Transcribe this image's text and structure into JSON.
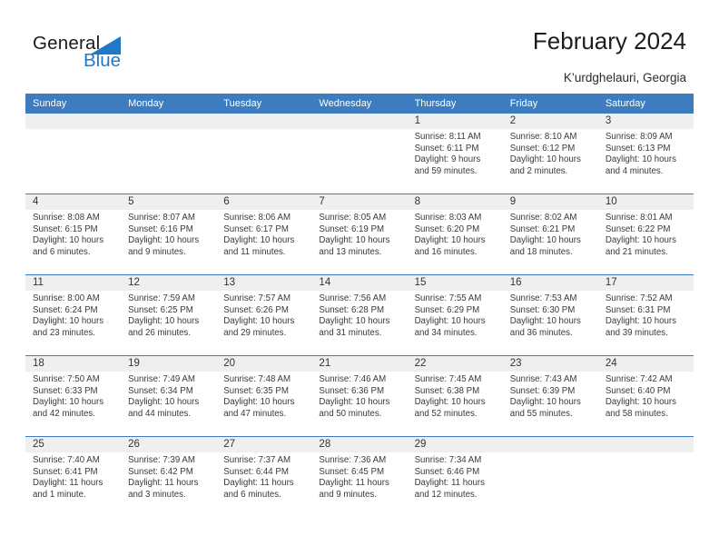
{
  "branding": {
    "name_part1": "General",
    "name_part2": "Blue",
    "triangle_color": "#2079c6",
    "text_color": "#1b1b1b"
  },
  "header": {
    "title": "February 2024",
    "location": "K’urdghelauri, Georgia",
    "header_bg": "#3c7cbf",
    "band_bg": "#efefef"
  },
  "weekdays": [
    "Sunday",
    "Monday",
    "Tuesday",
    "Wednesday",
    "Thursday",
    "Friday",
    "Saturday"
  ],
  "weeks": [
    [
      {
        "day": "",
        "sunrise": "",
        "sunset": "",
        "daylight": ""
      },
      {
        "day": "",
        "sunrise": "",
        "sunset": "",
        "daylight": ""
      },
      {
        "day": "",
        "sunrise": "",
        "sunset": "",
        "daylight": ""
      },
      {
        "day": "",
        "sunrise": "",
        "sunset": "",
        "daylight": ""
      },
      {
        "day": "1",
        "sunrise": "Sunrise: 8:11 AM",
        "sunset": "Sunset: 6:11 PM",
        "daylight": "Daylight: 9 hours and 59 minutes."
      },
      {
        "day": "2",
        "sunrise": "Sunrise: 8:10 AM",
        "sunset": "Sunset: 6:12 PM",
        "daylight": "Daylight: 10 hours and 2 minutes."
      },
      {
        "day": "3",
        "sunrise": "Sunrise: 8:09 AM",
        "sunset": "Sunset: 6:13 PM",
        "daylight": "Daylight: 10 hours and 4 minutes."
      }
    ],
    [
      {
        "day": "4",
        "sunrise": "Sunrise: 8:08 AM",
        "sunset": "Sunset: 6:15 PM",
        "daylight": "Daylight: 10 hours and 6 minutes."
      },
      {
        "day": "5",
        "sunrise": "Sunrise: 8:07 AM",
        "sunset": "Sunset: 6:16 PM",
        "daylight": "Daylight: 10 hours and 9 minutes."
      },
      {
        "day": "6",
        "sunrise": "Sunrise: 8:06 AM",
        "sunset": "Sunset: 6:17 PM",
        "daylight": "Daylight: 10 hours and 11 minutes."
      },
      {
        "day": "7",
        "sunrise": "Sunrise: 8:05 AM",
        "sunset": "Sunset: 6:19 PM",
        "daylight": "Daylight: 10 hours and 13 minutes."
      },
      {
        "day": "8",
        "sunrise": "Sunrise: 8:03 AM",
        "sunset": "Sunset: 6:20 PM",
        "daylight": "Daylight: 10 hours and 16 minutes."
      },
      {
        "day": "9",
        "sunrise": "Sunrise: 8:02 AM",
        "sunset": "Sunset: 6:21 PM",
        "daylight": "Daylight: 10 hours and 18 minutes."
      },
      {
        "day": "10",
        "sunrise": "Sunrise: 8:01 AM",
        "sunset": "Sunset: 6:22 PM",
        "daylight": "Daylight: 10 hours and 21 minutes."
      }
    ],
    [
      {
        "day": "11",
        "sunrise": "Sunrise: 8:00 AM",
        "sunset": "Sunset: 6:24 PM",
        "daylight": "Daylight: 10 hours and 23 minutes."
      },
      {
        "day": "12",
        "sunrise": "Sunrise: 7:59 AM",
        "sunset": "Sunset: 6:25 PM",
        "daylight": "Daylight: 10 hours and 26 minutes."
      },
      {
        "day": "13",
        "sunrise": "Sunrise: 7:57 AM",
        "sunset": "Sunset: 6:26 PM",
        "daylight": "Daylight: 10 hours and 29 minutes."
      },
      {
        "day": "14",
        "sunrise": "Sunrise: 7:56 AM",
        "sunset": "Sunset: 6:28 PM",
        "daylight": "Daylight: 10 hours and 31 minutes."
      },
      {
        "day": "15",
        "sunrise": "Sunrise: 7:55 AM",
        "sunset": "Sunset: 6:29 PM",
        "daylight": "Daylight: 10 hours and 34 minutes."
      },
      {
        "day": "16",
        "sunrise": "Sunrise: 7:53 AM",
        "sunset": "Sunset: 6:30 PM",
        "daylight": "Daylight: 10 hours and 36 minutes."
      },
      {
        "day": "17",
        "sunrise": "Sunrise: 7:52 AM",
        "sunset": "Sunset: 6:31 PM",
        "daylight": "Daylight: 10 hours and 39 minutes."
      }
    ],
    [
      {
        "day": "18",
        "sunrise": "Sunrise: 7:50 AM",
        "sunset": "Sunset: 6:33 PM",
        "daylight": "Daylight: 10 hours and 42 minutes."
      },
      {
        "day": "19",
        "sunrise": "Sunrise: 7:49 AM",
        "sunset": "Sunset: 6:34 PM",
        "daylight": "Daylight: 10 hours and 44 minutes."
      },
      {
        "day": "20",
        "sunrise": "Sunrise: 7:48 AM",
        "sunset": "Sunset: 6:35 PM",
        "daylight": "Daylight: 10 hours and 47 minutes."
      },
      {
        "day": "21",
        "sunrise": "Sunrise: 7:46 AM",
        "sunset": "Sunset: 6:36 PM",
        "daylight": "Daylight: 10 hours and 50 minutes."
      },
      {
        "day": "22",
        "sunrise": "Sunrise: 7:45 AM",
        "sunset": "Sunset: 6:38 PM",
        "daylight": "Daylight: 10 hours and 52 minutes."
      },
      {
        "day": "23",
        "sunrise": "Sunrise: 7:43 AM",
        "sunset": "Sunset: 6:39 PM",
        "daylight": "Daylight: 10 hours and 55 minutes."
      },
      {
        "day": "24",
        "sunrise": "Sunrise: 7:42 AM",
        "sunset": "Sunset: 6:40 PM",
        "daylight": "Daylight: 10 hours and 58 minutes."
      }
    ],
    [
      {
        "day": "25",
        "sunrise": "Sunrise: 7:40 AM",
        "sunset": "Sunset: 6:41 PM",
        "daylight": "Daylight: 11 hours and 1 minute."
      },
      {
        "day": "26",
        "sunrise": "Sunrise: 7:39 AM",
        "sunset": "Sunset: 6:42 PM",
        "daylight": "Daylight: 11 hours and 3 minutes."
      },
      {
        "day": "27",
        "sunrise": "Sunrise: 7:37 AM",
        "sunset": "Sunset: 6:44 PM",
        "daylight": "Daylight: 11 hours and 6 minutes."
      },
      {
        "day": "28",
        "sunrise": "Sunrise: 7:36 AM",
        "sunset": "Sunset: 6:45 PM",
        "daylight": "Daylight: 11 hours and 9 minutes."
      },
      {
        "day": "29",
        "sunrise": "Sunrise: 7:34 AM",
        "sunset": "Sunset: 6:46 PM",
        "daylight": "Daylight: 11 hours and 12 minutes."
      },
      {
        "day": "",
        "sunrise": "",
        "sunset": "",
        "daylight": ""
      },
      {
        "day": "",
        "sunrise": "",
        "sunset": "",
        "daylight": ""
      }
    ]
  ]
}
